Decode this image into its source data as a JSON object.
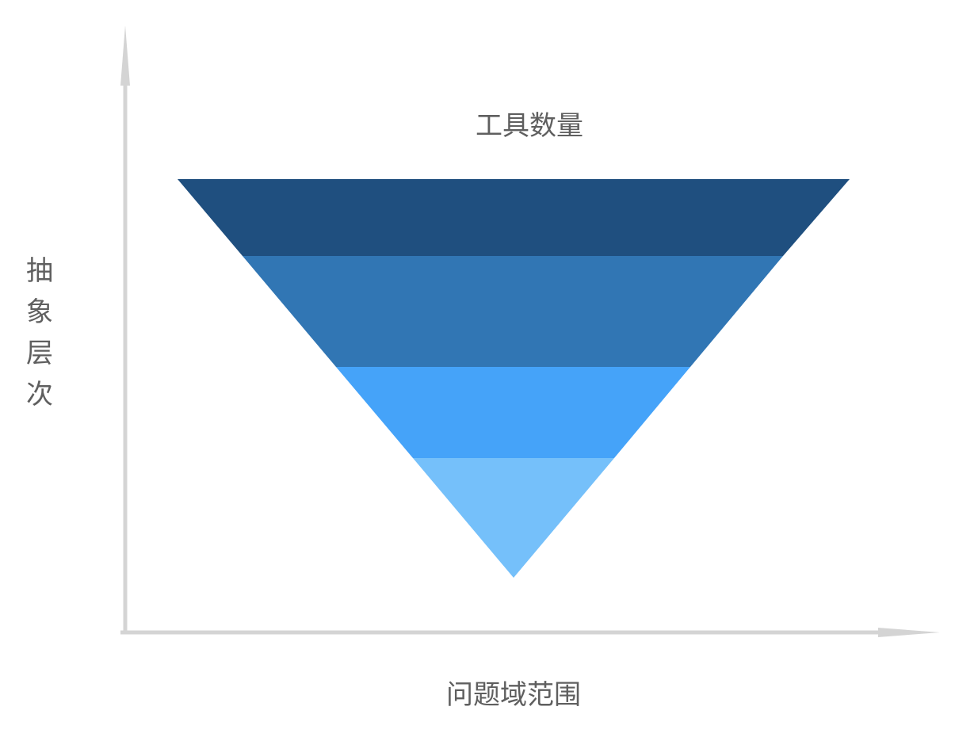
{
  "diagram": {
    "top_label": "工具数量",
    "x_axis_label": "问题域范围",
    "y_axis_label": [
      "抽",
      "象",
      "层",
      "次"
    ],
    "layers": [
      {
        "color": "#1f4f7f"
      },
      {
        "color": "#3176b4"
      },
      {
        "color": "#45a3f9"
      },
      {
        "color": "#75c0fa"
      }
    ],
    "axis_color": "#d4d4d4"
  }
}
